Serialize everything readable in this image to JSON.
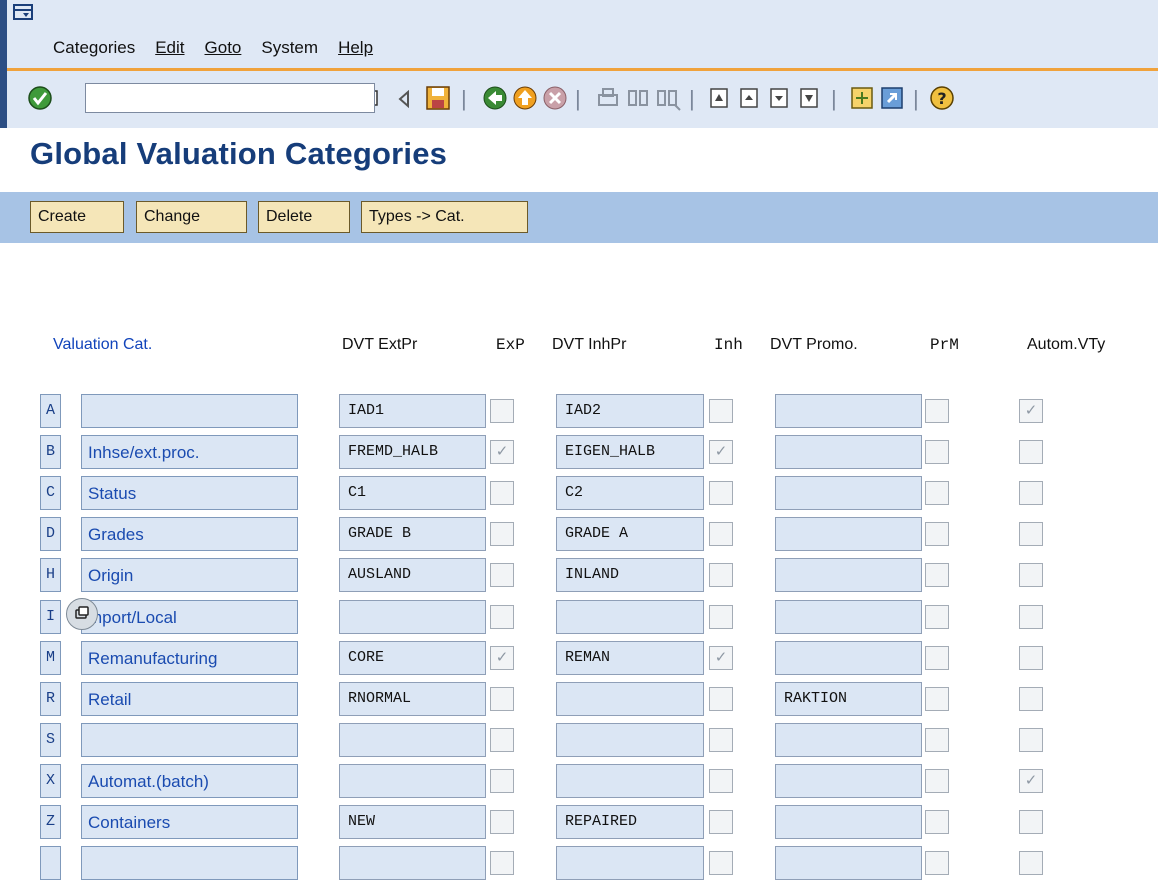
{
  "menu": {
    "items": [
      {
        "label": "Categories"
      },
      {
        "label": "Edit"
      },
      {
        "label": "Goto"
      },
      {
        "label": "System"
      },
      {
        "label": "Help"
      }
    ]
  },
  "toolbar": {
    "command_field_value": "",
    "icons": [
      "enter-icon",
      "command-history-icon",
      "back-arrow-icon",
      "save-icon",
      "back-icon",
      "exit-icon",
      "cancel-icon",
      "print-icon",
      "find-icon",
      "find-next-icon",
      "first-page-icon",
      "previous-page-icon",
      "next-page-icon",
      "last-page-icon",
      "new-session-icon",
      "shortcut-icon",
      "help-icon"
    ]
  },
  "page": {
    "title": "Global Valuation Categories"
  },
  "app_toolbar": {
    "create": "Create",
    "change": "Change",
    "delete": "Delete",
    "types_to_cat": "Types -> Cat."
  },
  "table": {
    "headers": {
      "valcat": "Valuation Cat.",
      "dvt_extpr": "DVT ExtPr",
      "exp": "ExP",
      "dvt_inhpr": "DVT InhPr",
      "inh": "Inh",
      "dvt_promo": "DVT Promo.",
      "prm": "PrM",
      "autom_vty": "Autom.VTy"
    },
    "rows": [
      {
        "key": "A",
        "desc": "",
        "extpr": "IAD1",
        "exp": false,
        "inhpr": "IAD2",
        "inh": false,
        "promo": "",
        "prm": false,
        "aut": true
      },
      {
        "key": "B",
        "desc": "Inhse/ext.proc.",
        "extpr": "FREMD_HALB",
        "exp": true,
        "inhpr": "EIGEN_HALB",
        "inh": true,
        "promo": "",
        "prm": false,
        "aut": false
      },
      {
        "key": "C",
        "desc": "Status",
        "extpr": "C1",
        "exp": false,
        "inhpr": "C2",
        "inh": false,
        "promo": "",
        "prm": false,
        "aut": false
      },
      {
        "key": "D",
        "desc": "Grades",
        "extpr": "GRADE B",
        "exp": false,
        "inhpr": "GRADE A",
        "inh": false,
        "promo": "",
        "prm": false,
        "aut": false
      },
      {
        "key": "H",
        "desc": "Origin",
        "extpr": "AUSLAND",
        "exp": false,
        "inhpr": "INLAND",
        "inh": false,
        "promo": "",
        "prm": false,
        "aut": false
      },
      {
        "key": "I",
        "desc": "mport/Local",
        "extpr": "",
        "exp": false,
        "inhpr": "",
        "inh": false,
        "promo": "",
        "prm": false,
        "aut": false
      },
      {
        "key": "M",
        "desc": "Remanufacturing",
        "extpr": "CORE",
        "exp": true,
        "inhpr": "REMAN",
        "inh": true,
        "promo": "",
        "prm": false,
        "aut": false
      },
      {
        "key": "R",
        "desc": "Retail",
        "extpr": "RNORMAL",
        "exp": false,
        "inhpr": "",
        "inh": false,
        "promo": "RAKTION",
        "prm": false,
        "aut": false
      },
      {
        "key": "S",
        "desc": "",
        "extpr": "",
        "exp": false,
        "inhpr": "",
        "inh": false,
        "promo": "",
        "prm": false,
        "aut": false
      },
      {
        "key": "X",
        "desc": "Automat.(batch)",
        "extpr": "",
        "exp": false,
        "inhpr": "",
        "inh": false,
        "promo": "",
        "prm": false,
        "aut": true
      },
      {
        "key": "Z",
        "desc": "Containers",
        "extpr": "NEW",
        "exp": false,
        "inhpr": "REPAIRED",
        "inh": false,
        "promo": "",
        "prm": false,
        "aut": false
      },
      {
        "key": "",
        "desc": "",
        "extpr": "",
        "exp": false,
        "inhpr": "",
        "inh": false,
        "promo": "",
        "prm": false,
        "aut": false
      }
    ]
  },
  "check_mark": "✓"
}
